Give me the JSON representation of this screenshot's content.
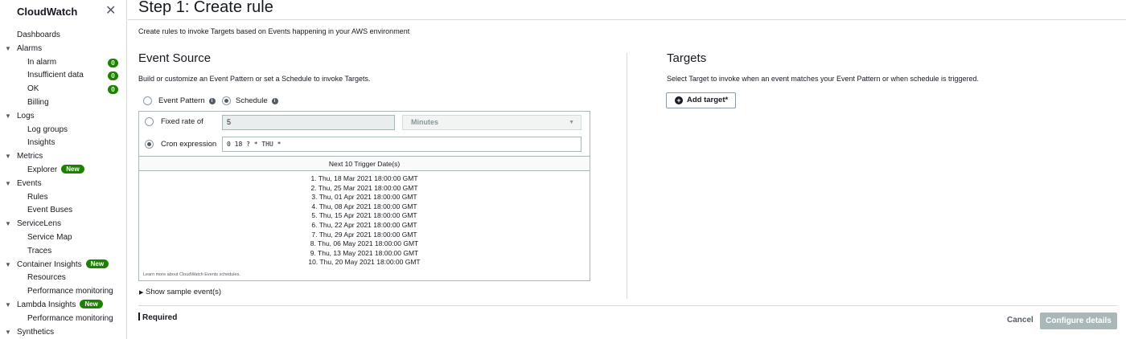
{
  "sidebar": {
    "title": "CloudWatch",
    "close_icon": "close-icon",
    "items": [
      {
        "label": "Dashboards",
        "level": 0,
        "caret": false
      },
      {
        "label": "Alarms",
        "level": 0,
        "caret": true
      },
      {
        "label": "In alarm",
        "level": 1,
        "count": "0"
      },
      {
        "label": "Insufficient data",
        "level": 1,
        "count": "0"
      },
      {
        "label": "OK",
        "level": 1,
        "count": "0"
      },
      {
        "label": "Billing",
        "level": 1
      },
      {
        "label": "Logs",
        "level": 0,
        "caret": true
      },
      {
        "label": "Log groups",
        "level": 1
      },
      {
        "label": "Insights",
        "level": 1
      },
      {
        "label": "Metrics",
        "level": 0,
        "caret": true
      },
      {
        "label": "Explorer",
        "level": 1,
        "badge": "New"
      },
      {
        "label": "Events",
        "level": 0,
        "caret": true
      },
      {
        "label": "Rules",
        "level": 1
      },
      {
        "label": "Event Buses",
        "level": 1
      },
      {
        "label": "ServiceLens",
        "level": 0,
        "caret": true
      },
      {
        "label": "Service Map",
        "level": 1
      },
      {
        "label": "Traces",
        "level": 1
      },
      {
        "label": "Container Insights",
        "level": 0,
        "caret": true,
        "badge": "New"
      },
      {
        "label": "Resources",
        "level": 1
      },
      {
        "label": "Performance monitoring",
        "level": 1
      },
      {
        "label": "Lambda Insights",
        "level": 0,
        "caret": true,
        "badge": "New"
      },
      {
        "label": "Performance monitoring",
        "level": 1
      },
      {
        "label": "Synthetics",
        "level": 0,
        "caret": true
      }
    ]
  },
  "header": {
    "title": "Step 1: Create rule",
    "intro": "Create rules to invoke Targets based on Events happening in your AWS environment"
  },
  "event_source": {
    "title": "Event Source",
    "description": "Build or customize an Event Pattern or set a Schedule to invoke Targets.",
    "option_event_pattern": "Event Pattern",
    "option_schedule": "Schedule",
    "selected_option": "Schedule",
    "fixed_rate_label": "Fixed rate of",
    "fixed_rate_value": "5",
    "fixed_rate_unit": "Minutes",
    "cron_label": "Cron expression",
    "cron_value": "0 18 ? * THU *",
    "selected_schedule_type": "cron",
    "trigger_header": "Next 10 Trigger Date(s)",
    "trigger_dates": [
      "1. Thu, 18 Mar 2021 18:00:00 GMT",
      "2. Thu, 25 Mar 2021 18:00:00 GMT",
      "3. Thu, 01 Apr 2021 18:00:00 GMT",
      "4. Thu, 08 Apr 2021 18:00:00 GMT",
      "5. Thu, 15 Apr 2021 18:00:00 GMT",
      "6. Thu, 22 Apr 2021 18:00:00 GMT",
      "7. Thu, 29 Apr 2021 18:00:00 GMT",
      "8. Thu, 06 May 2021 18:00:00 GMT",
      "9. Thu, 13 May 2021 18:00:00 GMT",
      "10. Thu, 20 May 2021 18:00:00 GMT"
    ],
    "learn_more": "Learn more about CloudWatch Events schedules.",
    "show_sample": "Show sample event(s)"
  },
  "targets": {
    "title": "Targets",
    "description": "Select Target to invoke when an event matches your Event Pattern or when schedule is triggered.",
    "add_target": "Add target*"
  },
  "footer": {
    "required": "Required",
    "cancel": "Cancel",
    "configure": "Configure details"
  }
}
